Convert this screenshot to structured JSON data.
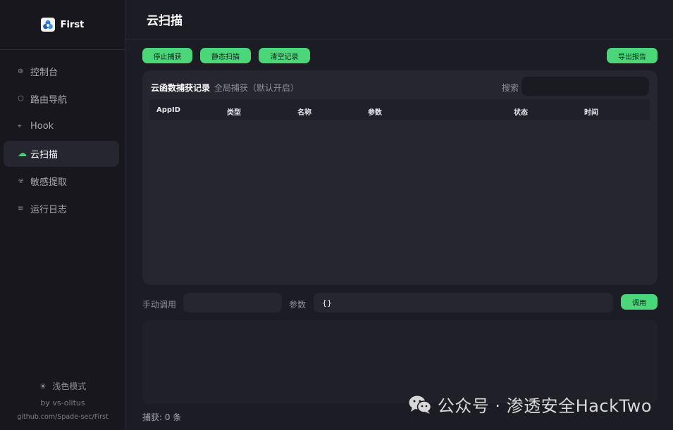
{
  "brand": {
    "title": "First",
    "logo_icon": "cloud-cluster-icon"
  },
  "sidebar": {
    "items": [
      {
        "label": "控制台",
        "icon": "dashboard-icon",
        "glyph": "⊚",
        "active": false
      },
      {
        "label": "路由导航",
        "icon": "hexagon-icon",
        "glyph": "⬡",
        "active": false
      },
      {
        "label": "Hook",
        "icon": "hook-icon",
        "glyph": "⌖",
        "active": false
      },
      {
        "label": "云扫描",
        "icon": "cloud-icon",
        "glyph": "☁",
        "active": true
      },
      {
        "label": "敏感提取",
        "icon": "biohazard-icon",
        "glyph": "☣",
        "active": false
      },
      {
        "label": "运行日志",
        "icon": "list-icon",
        "glyph": "≡",
        "active": false
      }
    ],
    "theme_toggle": "浅色模式",
    "author": "by vs-olitus",
    "github": "github.com/Spade-sec/First"
  },
  "header": {
    "title": "云扫描"
  },
  "toolbar": {
    "stop_capture": "停止捕获",
    "static_scan": "静态扫描",
    "clear_records": "清空记录",
    "export_report": "导出报告"
  },
  "panel": {
    "title": "云函数捕获记录",
    "subtitle": "全局捕获（默认开启）",
    "search_label": "搜索",
    "search_value": "",
    "columns": [
      "AppID",
      "类型",
      "名称",
      "参数",
      "状态",
      "时间"
    ],
    "rows": []
  },
  "manual": {
    "label": "手动调用",
    "value": "",
    "param_label": "参数",
    "param_value": "{}",
    "invoke_button": "调用"
  },
  "status": {
    "count_text": "捕获: 0 条"
  },
  "watermark": {
    "text": "公众号 · 渗透安全HackTwo"
  },
  "colors": {
    "accent": "#4cd67a",
    "background": "#1c1c24",
    "sidebar": "#17171d",
    "panel": "#262630"
  }
}
